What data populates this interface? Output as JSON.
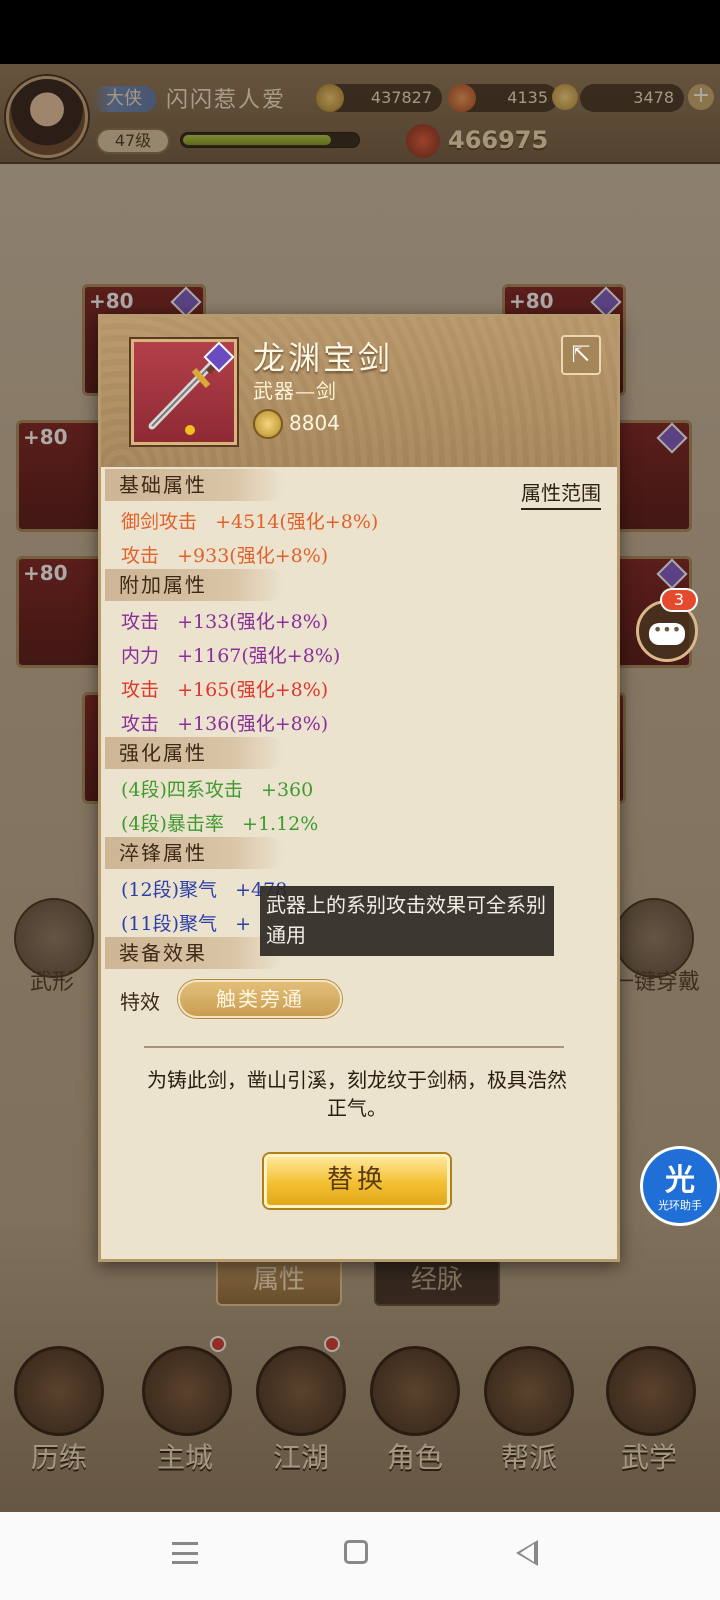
{
  "header": {
    "title_badge": "大侠",
    "player_name": "闪闪惹人爱",
    "coins": "437827",
    "tokens": "4135",
    "gold": "3478",
    "level": "47级",
    "exp_fraction": 0.85,
    "power": "466975"
  },
  "slots": {
    "level_label": "+80"
  },
  "side": {
    "left_label": "武形",
    "right_label": "一键穿戴"
  },
  "item": {
    "name": "龙渊宝剑",
    "type": "武器—剑",
    "power": "8804",
    "share_icon": "share-icon"
  },
  "sections": {
    "base": "基础属性",
    "extra": "附加属性",
    "enhance": "强化属性",
    "temper": "淬锋属性",
    "effect": "装备效果"
  },
  "range_link": "属性范围",
  "attributes": {
    "base": [
      "御剑攻击   +4514(强化+8%)",
      "攻击   +933(强化+8%)"
    ],
    "extra": [
      "攻击   +133(强化+8%)",
      "内力   +1167(强化+8%)",
      "攻击   +165(强化+8%)",
      "攻击   +136(强化+8%)"
    ],
    "enhance": [
      "(4段)四系攻击   +360",
      "(4段)暴击率   +1.12%"
    ],
    "temper": [
      "(12段)聚气   +478",
      "(11段)聚气   +"
    ]
  },
  "tooltip": "武器上的系别攻击效果可全系别通用",
  "effect": {
    "label": "特效",
    "pill": "触类旁通"
  },
  "flavor": "为铸此剑，凿山引溪，刻龙纹于剑柄，极具浩然正气。",
  "replace_button": "替换",
  "chat": {
    "badge": "3"
  },
  "assistant": {
    "glyph": "光",
    "label": "光环助手"
  },
  "tabs": {
    "attributes": "属性",
    "meridians": "经脉"
  },
  "bottom_nav": [
    "历练",
    "主城",
    "江湖",
    "角色",
    "帮派",
    "武学"
  ],
  "colors": {
    "orange": "#e0622a",
    "purple": "#8a2f9a",
    "red": "#e0362c",
    "green": "#3f9a30",
    "blue": "#2c3fa8",
    "gold_button": "#f3c030"
  }
}
